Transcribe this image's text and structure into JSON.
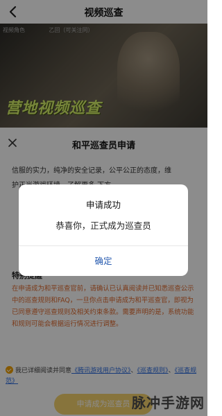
{
  "nav": {
    "title": "视频巡查"
  },
  "banner": {
    "top_labels": [
      "视频角色",
      "乙回（可关注同）"
    ],
    "text": "营地视频巡查"
  },
  "sheet": {
    "title": "和平巡查员申请",
    "body_lines": [
      "信服的实力，纯净的安全记录，公平公正的态度，维",
      "护正当游戏环境…了解更多 下方"
    ],
    "notice_title": "特别提醒",
    "notice_text": "在申请成为和平巡查官前，请确认已认真阅读并已知悉巡查公示中的巡查规则和FAQ，一旦你点击申请成为和平巡查官，即视为已同意遵守巡查规则及相关约束条款。需要声明的是，系统功能和规则可能会根据运行情况进行调整。",
    "agree_prefix": "我已详细阅读并同意",
    "agree_link1": "《腾讯游戏用户协议》",
    "agree_link2": "《巡查规则》",
    "agree_link3": "《巡查规范》",
    "agree_sep1": "、",
    "agree_sep2": "、",
    "apply_label": "申请成为巡查员"
  },
  "dialog": {
    "title": "申请成功",
    "message": "恭喜你，正式成为巡查员",
    "confirm_label": "确定"
  },
  "watermark": "脉冲手游网",
  "colors": {
    "accent": "#2a5db0",
    "notice": "#e06a2e",
    "check": "#f0a000",
    "apply_button": "#f6d36e"
  },
  "icons": {
    "back": "chevron-left-icon",
    "close": "close-icon",
    "check": "check-circle-icon"
  }
}
